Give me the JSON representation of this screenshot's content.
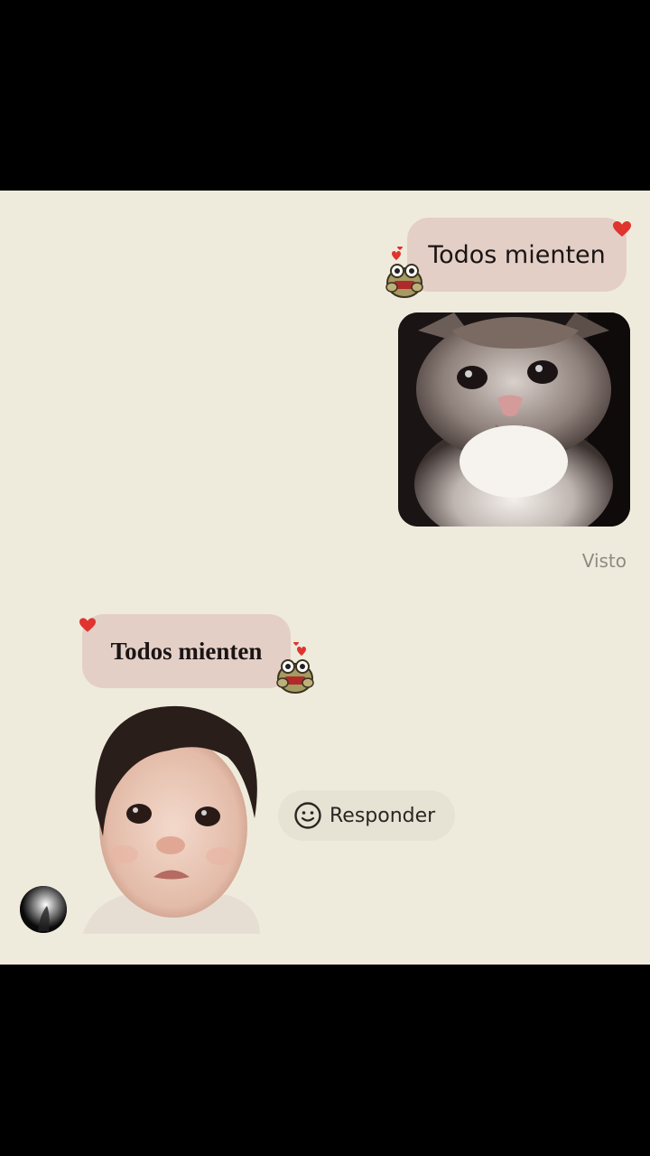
{
  "messages": {
    "sent_text": "Todos mienten",
    "received_text": "Todos mienten",
    "seen_status": "Visto"
  },
  "reply_button": {
    "label": "Responder",
    "icon": "smiley-icon"
  },
  "icons": {
    "sent_sticker": "frog-sticker-icon",
    "received_sticker": "frog-sticker-icon",
    "heart": "heart-icon"
  },
  "colors": {
    "chat_background": "#efebdc",
    "bubble": "#e3cfc6",
    "heart": "#e0342f",
    "letterbox": "#000000"
  }
}
